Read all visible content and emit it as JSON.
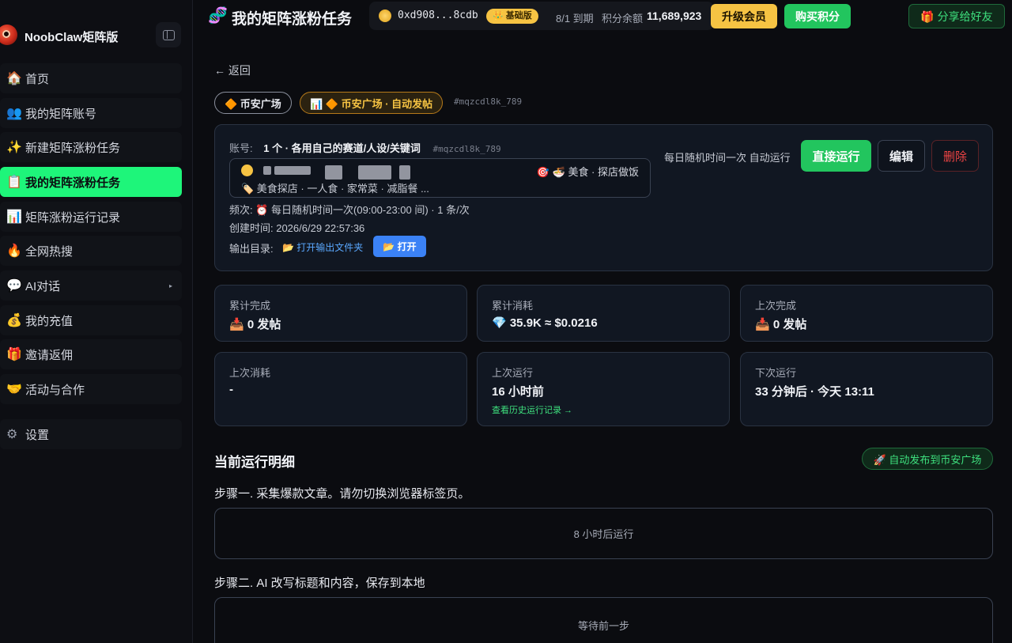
{
  "sidebar": {
    "brand": "NoobClaw矩阵版",
    "items": [
      {
        "emoji": "🏠",
        "label": "首页"
      },
      {
        "emoji": "👥",
        "label": "我的矩阵账号"
      },
      {
        "emoji": "✨",
        "label": "新建矩阵涨粉任务"
      },
      {
        "emoji": "📋",
        "label": "我的矩阵涨粉任务"
      },
      {
        "emoji": "📊",
        "label": "矩阵涨粉运行记录"
      },
      {
        "emoji": "🔥",
        "label": "全网热搜"
      },
      {
        "emoji": "💬",
        "label": "AI对话"
      },
      {
        "emoji": "💰",
        "label": "我的充值"
      },
      {
        "emoji": "🎁",
        "label": "邀请返佣"
      },
      {
        "emoji": "🤝",
        "label": "活动与合作"
      },
      {
        "emoji": "⚙",
        "label": "设置"
      }
    ],
    "active_index": 3
  },
  "topbar": {
    "icon": "🧬",
    "title": "我的矩阵涨粉任务",
    "wallet_address": "0xd908...8cdb",
    "tier": "👑 基础版",
    "expire": "8/1 到期",
    "balance_label": "积分余额",
    "balance": "11,689,923",
    "upgrade_label": "升级会员",
    "buy_label": "购买积分",
    "share_label": "🎁 分享给好友"
  },
  "main": {
    "back_label": "← 返回",
    "tag1": "🔶 币安广场",
    "tag2": "📊 🔶 币安广场 · 自动发帖",
    "task_id": "#mqzcdl8k_789",
    "task": {
      "account_label": "账号:",
      "account_value": "1 个 · 各用自己的赛道/人设/关键词",
      "account_hash": "#mqzcdl8k_789",
      "account_tags": "🎯 🍜 美食 · 探店做饭",
      "account_desc": "🏷️ 美食探店 · 一人食 · 家常菜 · 减脂餐 ...",
      "freq": "频次: ⏰ 每日随机时间一次(09:00-23:00 间) · 1 条/次",
      "created": "创建时间: 2026/6/29 22:57:36",
      "outdir_label": "输出目录:",
      "outdir_link": "📂 打开输出文件夹",
      "open_btn": "📂 打开",
      "schedule": "每日随机时间一次 自动运行",
      "run_btn": "直接运行",
      "edit_btn": "编辑",
      "delete_btn": "删除"
    },
    "stats": [
      {
        "label": "累计完成",
        "value": "📥 0 发帖"
      },
      {
        "label": "累计消耗",
        "value": "💎 35.9K ≈ $0.0216"
      },
      {
        "label": "上次完成",
        "value": "📥 0 发帖"
      },
      {
        "label": "上次消耗",
        "value": "-"
      },
      {
        "label": "上次运行",
        "value": "16 小时前",
        "link": "查看历史运行记录 →"
      },
      {
        "label": "下次运行",
        "value": "33 分钟后 · 今天 13:11"
      }
    ],
    "section_title": "当前运行明细",
    "auto_publish": "🚀 自动发布到币安广场",
    "steps": [
      {
        "title": "步骤一. 采集爆款文章。请勿切换浏览器标签页。",
        "status": "8 小时后运行"
      },
      {
        "title": "步骤二. AI 改写标题和内容，保存到本地",
        "status": "等待前一步"
      }
    ]
  }
}
